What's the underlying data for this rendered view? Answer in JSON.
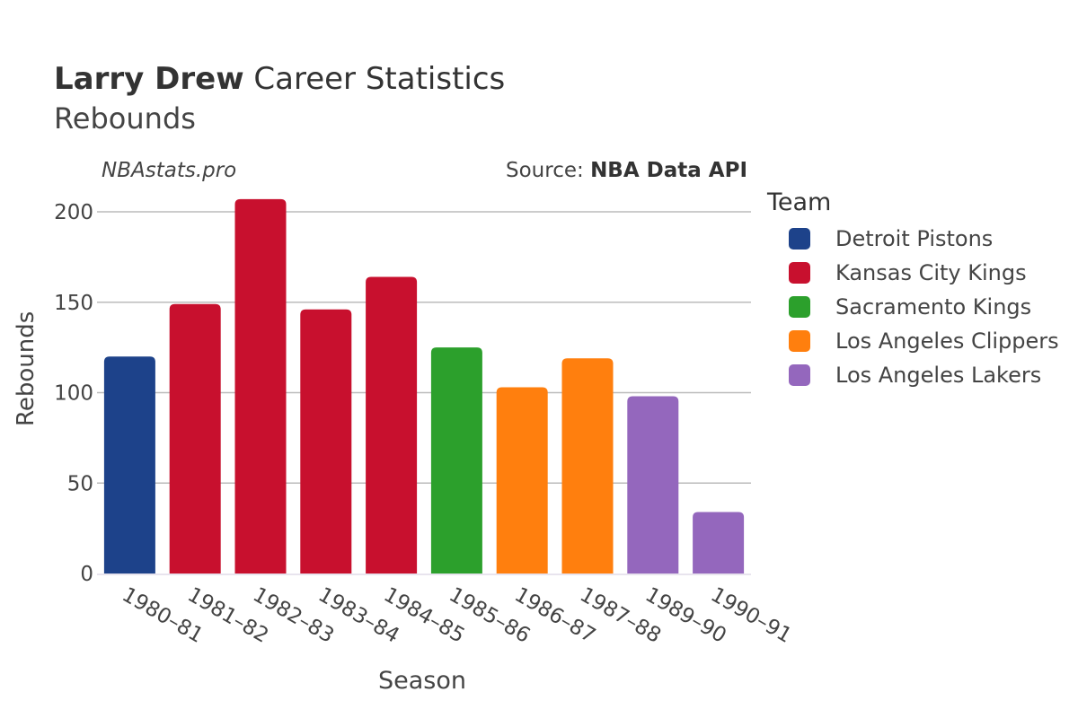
{
  "header": {
    "title_bold": "Larry Drew",
    "title_rest": " Career Statistics",
    "subtitle": "Rebounds",
    "watermark": "NBAstats.pro",
    "source_prefix": "Source: ",
    "source_name": "NBA Data API"
  },
  "legend": {
    "title": "Team",
    "items": [
      {
        "label": "Detroit Pistons",
        "color": "#1d428a"
      },
      {
        "label": "Kansas City Kings",
        "color": "#c8102e"
      },
      {
        "label": "Sacramento Kings",
        "color": "#2ca02c"
      },
      {
        "label": "Los Angeles Clippers",
        "color": "#ff7f0e"
      },
      {
        "label": "Los Angeles Lakers",
        "color": "#9467bd"
      }
    ]
  },
  "chart_data": {
    "type": "bar",
    "title": "Larry Drew Career Statistics",
    "subtitle": "Rebounds",
    "xlabel": "Season",
    "ylabel": "Rebounds",
    "ylim": [
      0,
      210
    ],
    "yticks": [
      0,
      50,
      100,
      150,
      200
    ],
    "grid": true,
    "legend_position": "right",
    "categories": [
      "1980–81",
      "1981–82",
      "1982–83",
      "1983–84",
      "1984–85",
      "1985–86",
      "1986–87",
      "1987–88",
      "1989–90",
      "1990–91"
    ],
    "values": [
      120,
      149,
      207,
      146,
      164,
      125,
      103,
      119,
      98,
      34
    ],
    "teams": [
      "Detroit Pistons",
      "Kansas City Kings",
      "Kansas City Kings",
      "Kansas City Kings",
      "Kansas City Kings",
      "Sacramento Kings",
      "Los Angeles Clippers",
      "Los Angeles Clippers",
      "Los Angeles Lakers",
      "Los Angeles Lakers"
    ]
  }
}
